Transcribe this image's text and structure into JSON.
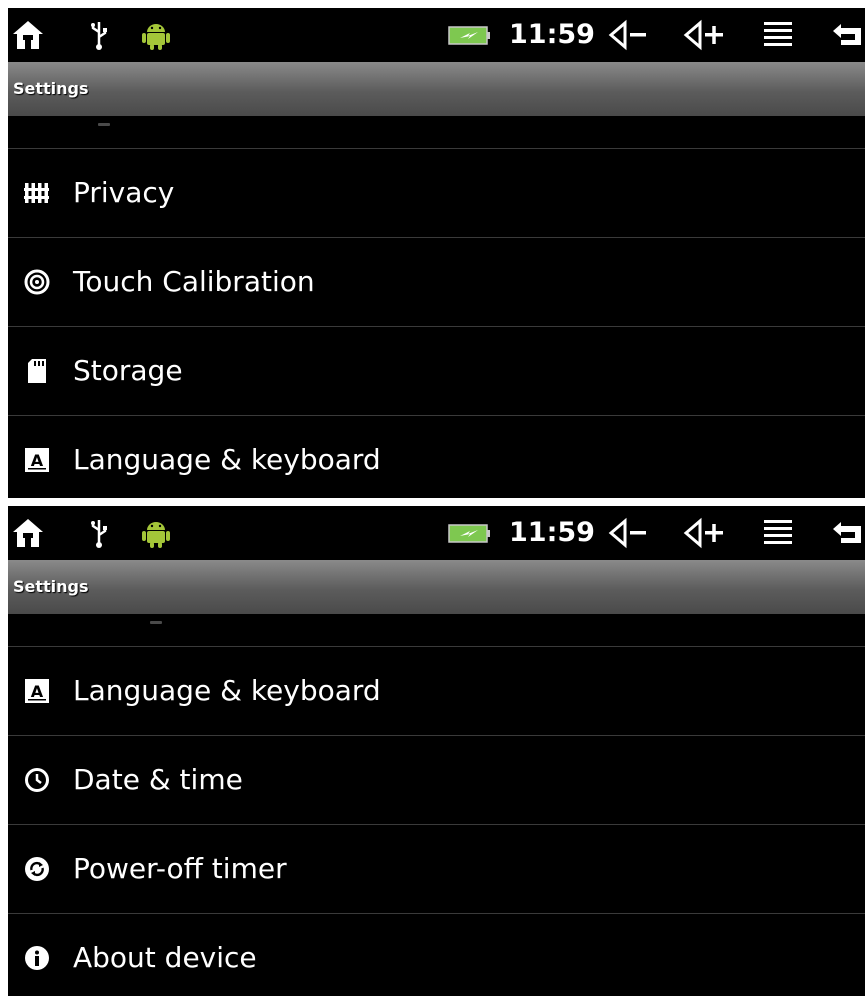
{
  "statusbar": {
    "time": "11:59",
    "icons": [
      "home-icon",
      "usb-icon",
      "android-debug-icon",
      "battery-charging-icon",
      "volume-down-icon",
      "volume-up-icon",
      "menu-icon",
      "back-icon"
    ]
  },
  "screen1": {
    "title": "Settings",
    "items": [
      {
        "icon": "privacy-icon",
        "label": "Privacy"
      },
      {
        "icon": "touch-calibration-icon",
        "label": "Touch Calibration"
      },
      {
        "icon": "sd-card-icon",
        "label": "Storage"
      },
      {
        "icon": "language-icon",
        "label": "Language & keyboard"
      }
    ]
  },
  "screen2": {
    "title": "Settings",
    "items": [
      {
        "icon": "language-icon",
        "label": "Language & keyboard"
      },
      {
        "icon": "clock-icon",
        "label": "Date & time"
      },
      {
        "icon": "power-timer-icon",
        "label": "Power-off timer"
      },
      {
        "icon": "info-icon",
        "label": "About device"
      }
    ]
  },
  "colors": {
    "background": "#000000",
    "text": "#ffffff",
    "divider": "#3a3a3a",
    "android_green": "#a4c639",
    "battery_green": "#7ec850"
  }
}
